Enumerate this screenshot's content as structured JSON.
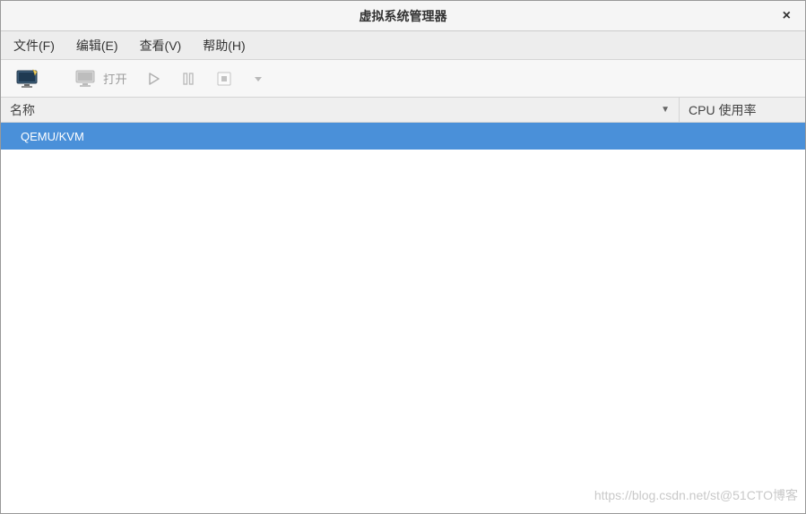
{
  "window": {
    "title": "虚拟系统管理器",
    "close_glyph": "×"
  },
  "menubar": {
    "file": "文件(F)",
    "edit": "编辑(E)",
    "view": "查看(V)",
    "help": "帮助(H)"
  },
  "toolbar": {
    "open_label": "打开"
  },
  "columns": {
    "name": "名称",
    "cpu": "CPU 使用率",
    "sort_glyph": "▼"
  },
  "tree": {
    "rows": [
      {
        "label": "QEMU/KVM",
        "selected": true
      }
    ]
  },
  "watermark": "https://blog.csdn.net/st@51CTO博客"
}
